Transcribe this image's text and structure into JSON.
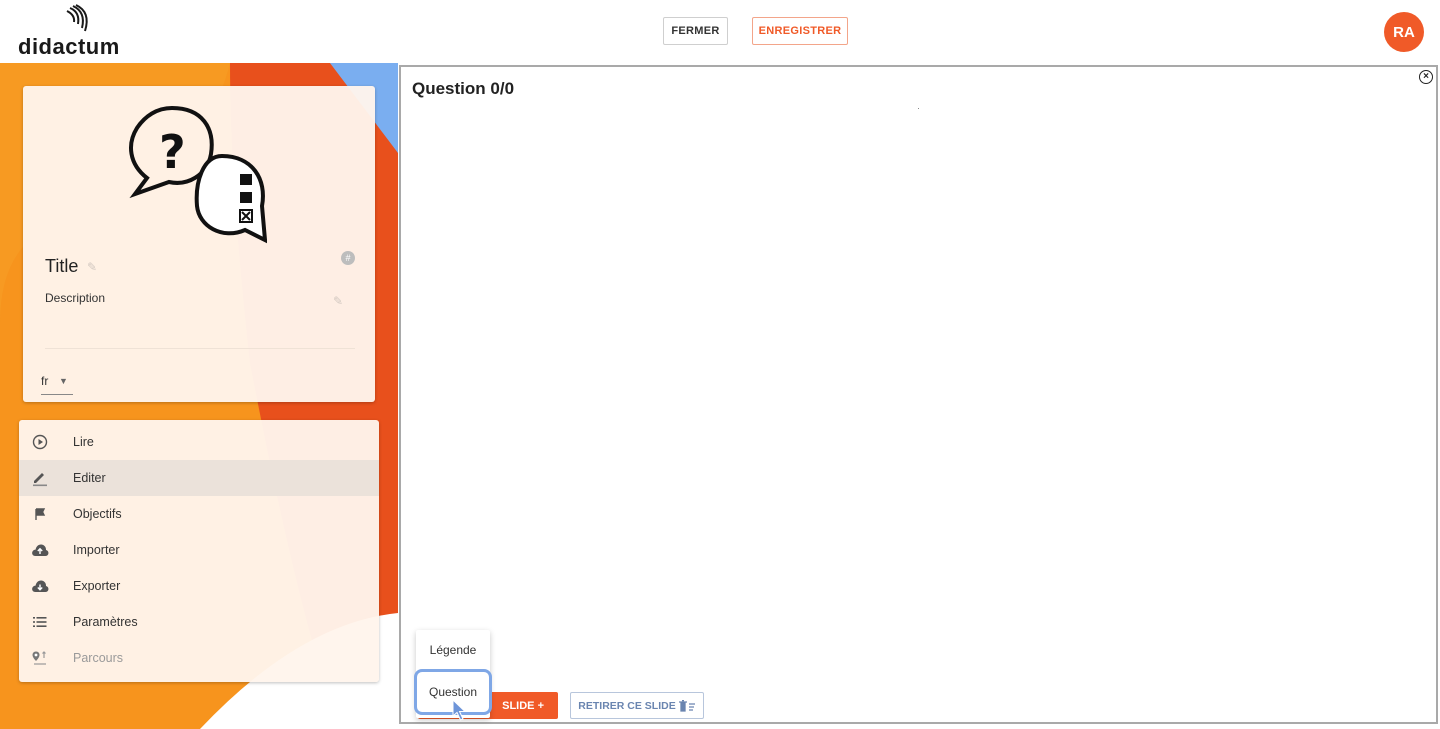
{
  "header": {
    "brand": "didactum",
    "close_label": "FERMER",
    "save_label": "ENREGISTRER",
    "avatar_initials": "RA"
  },
  "info_card": {
    "title": "Title",
    "description": "Description",
    "hash_badge": "#",
    "language": "fr"
  },
  "menu": {
    "items": [
      {
        "label": "Lire",
        "icon": "play-circle-icon",
        "active": false,
        "disabled": false
      },
      {
        "label": "Editer",
        "icon": "pencil-icon",
        "active": true,
        "disabled": false
      },
      {
        "label": "Objectifs",
        "icon": "flag-icon",
        "active": false,
        "disabled": false
      },
      {
        "label": "Importer",
        "icon": "cloud-upload-icon",
        "active": false,
        "disabled": false
      },
      {
        "label": "Exporter",
        "icon": "cloud-download-icon",
        "active": false,
        "disabled": false
      },
      {
        "label": "Paramètres",
        "icon": "list-icon",
        "active": false,
        "disabled": false
      },
      {
        "label": "Parcours",
        "icon": "route-icon",
        "active": false,
        "disabled": true
      }
    ]
  },
  "editor": {
    "question_title": "Question 0/0",
    "add_slide_label": "SLIDE +",
    "remove_slide_label": "RETIRER CE SLIDE"
  },
  "dropdown": {
    "items": [
      "Légende",
      "Question"
    ],
    "highlighted": "Question"
  },
  "colors": {
    "accent": "#f05a28",
    "orange": "#f7941d",
    "blue": "#7aaef0",
    "focus_ring": "#7fa7e6"
  }
}
